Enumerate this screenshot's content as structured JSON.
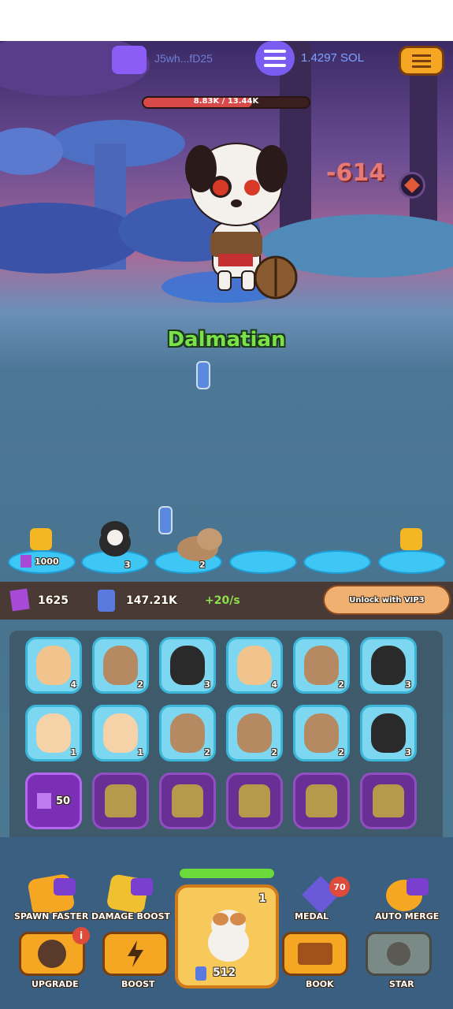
{
  "topbar": {
    "wallet_label": "J5wh...fD25",
    "sol_balance": "1.4297 SOL"
  },
  "boss": {
    "hp_text": "8.83K / 13.44K",
    "hp_fraction": 0.657,
    "damage_popup": "-614",
    "name": "Dalmatian"
  },
  "pads": [
    {
      "state": "locked",
      "cost": "1000"
    },
    {
      "state": "cat",
      "level": "3"
    },
    {
      "state": "cat",
      "level": "2"
    },
    {
      "state": "empty"
    },
    {
      "state": "empty"
    },
    {
      "state": "locked"
    }
  ],
  "resources": {
    "gems": "1625",
    "coins": "147.21K",
    "rate": "+20/s",
    "vip_button": "Unlock with VIP3"
  },
  "grid": {
    "row1": [
      "4",
      "2",
      "3",
      "4",
      "2",
      "3"
    ],
    "row2": [
      "1",
      "1",
      "2",
      "2",
      "2",
      "3"
    ],
    "gem_slot_cost": "50"
  },
  "bottom": {
    "spawn_faster": "SPAWN FASTER",
    "damage_boost": "DAMAGE BOOST",
    "medal_label": "MEDAL",
    "medal_badge": "70",
    "auto_merge": "AUTO MERGE",
    "upgrade": "UPGRADE",
    "boost": "BOOST",
    "book": "BOOK",
    "star": "STAR",
    "spawn_level": "1",
    "spawn_cost": "512",
    "spawn_progress": 1.0,
    "upgrade_badge": "i"
  },
  "colors": {
    "orange": "#f5a623",
    "hp_red": "#d84a4a",
    "name_green": "#7be04a",
    "purple_locked": "#6a2f94"
  }
}
